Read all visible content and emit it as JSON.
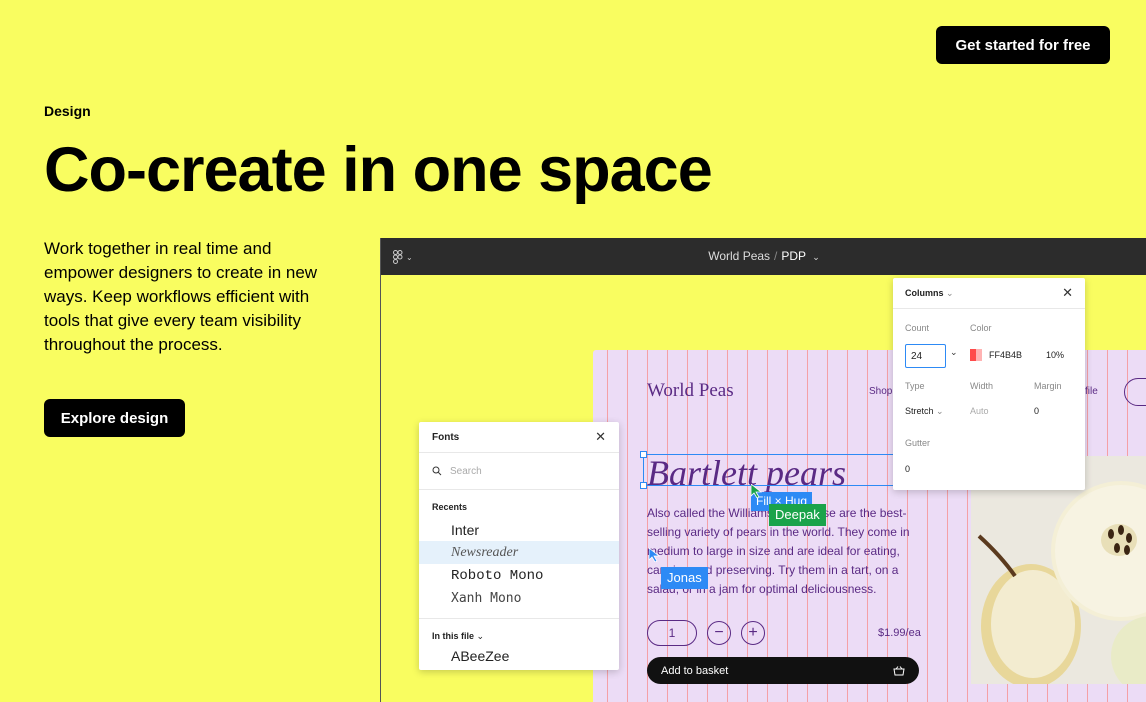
{
  "header": {
    "cta_label": "Get started for free"
  },
  "hero": {
    "eyebrow": "Design",
    "title": "Co-create in one space",
    "body": "Work together in real time and empower designers to create in new ways. Keep workflows efficient with tools that give every team visibility throughout the process.",
    "cta_label": "Explore design"
  },
  "app": {
    "breadcrumb_project": "World Peas",
    "breadcrumb_sep": "/",
    "breadcrumb_page": "PDP",
    "canvas": {
      "brand": "World Peas",
      "nav_shop": "Shop",
      "nav_profile": "file",
      "product_title": "Bartlett pears",
      "product_desc": "Also called the Williams pear, these are the best-selling variety of pears in the world. They come in medium to large in size and are ideal for eating, canning and preserving. Try them in a tart, on a salad, or in a jam for optimal deliciousness.",
      "qty": "1",
      "minus": "−",
      "plus": "+",
      "price": "$1.99/ea",
      "basket_label": "Add to basket",
      "fill_tag": "Fill × Hug",
      "cursor_1": "Deepak",
      "cursor_2": "Jonas"
    },
    "fonts_panel": {
      "title": "Fonts",
      "search_placeholder": "Search",
      "recents_label": "Recents",
      "recents": [
        "Inter",
        "Newsreader",
        "Roboto Mono",
        "Xanh Mono"
      ],
      "in_file_label": "In this file",
      "in_file_preview": "ABeeZee"
    },
    "columns_panel": {
      "title": "Columns",
      "count_label": "Count",
      "count_value": "24",
      "color_label": "Color",
      "color_hex": "FF4B4B",
      "color_opacity": "10%",
      "type_label": "Type",
      "type_value": "Stretch",
      "width_label": "Width",
      "width_value": "Auto",
      "margin_label": "Margin",
      "margin_value": "0",
      "gutter_label": "Gutter",
      "gutter_value": "0"
    }
  },
  "colors": {
    "background": "#f9fd60",
    "accent_blue": "#2d8af5",
    "accent_green": "#1aa34a",
    "brand_purple": "#5a2a84",
    "grid_red": "#ff4b4b"
  }
}
